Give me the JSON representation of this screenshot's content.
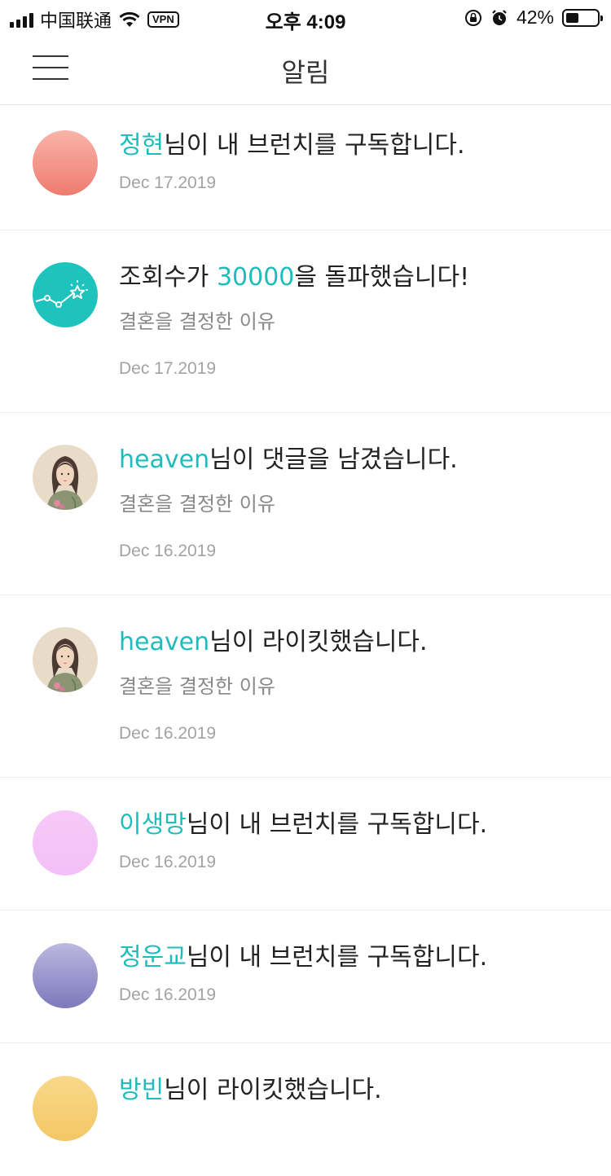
{
  "status_bar": {
    "carrier": "中国联通",
    "vpn": "VPN",
    "time": "오후 4:09",
    "battery": "42%",
    "battery_level": 0.42
  },
  "header": {
    "title": "알림"
  },
  "notifications": [
    {
      "highlight": "정현",
      "text": "님이 내 브런치를 구독합니다.",
      "subtitle": "",
      "date": "Dec 17.2019",
      "avatar": "gradient-avatar",
      "avatar_colors": [
        "#f8b4a8",
        "#ef7b70"
      ]
    },
    {
      "prefix": "조회수가 ",
      "highlight": "30000",
      "text": "을 돌파했습니다!",
      "subtitle": "결혼을 결정한 이유",
      "date": "Dec 17.2019",
      "avatar": "stats-star-icon",
      "avatar_colors": [
        "#1fc3bd",
        "#1fc3bd"
      ]
    },
    {
      "highlight": "heaven",
      "text": "님이 댓글을 남겼습니다.",
      "subtitle": "결혼을 결정한 이유",
      "date": "Dec 16.2019",
      "avatar": "illustrated-woman-avatar"
    },
    {
      "highlight": "heaven",
      "text": "님이 라이킷했습니다.",
      "subtitle": "결혼을 결정한 이유",
      "date": "Dec 16.2019",
      "avatar": "illustrated-woman-avatar"
    },
    {
      "highlight": "이생망",
      "text": "님이 내 브런치를 구독합니다.",
      "subtitle": "",
      "date": "Dec 16.2019",
      "avatar": "gradient-avatar",
      "avatar_colors": [
        "#f6c9f8",
        "#f3c0f7"
      ]
    },
    {
      "highlight": "정운교",
      "text": "님이 내 브런치를 구독합니다.",
      "subtitle": "",
      "date": "Dec 16.2019",
      "avatar": "gradient-avatar",
      "avatar_colors": [
        "#bdb8de",
        "#7d79bd"
      ]
    },
    {
      "highlight": "방빈",
      "text": "님이 라이킷했습니다.",
      "subtitle": "",
      "date": "",
      "avatar": "gradient-avatar",
      "avatar_colors": [
        "#f8d98a",
        "#f3c766"
      ]
    }
  ],
  "colors": {
    "accent": "#1fbcbc",
    "text": "#222222",
    "subtext": "#888888",
    "date": "#a3a3a3",
    "divider": "#ececec"
  }
}
